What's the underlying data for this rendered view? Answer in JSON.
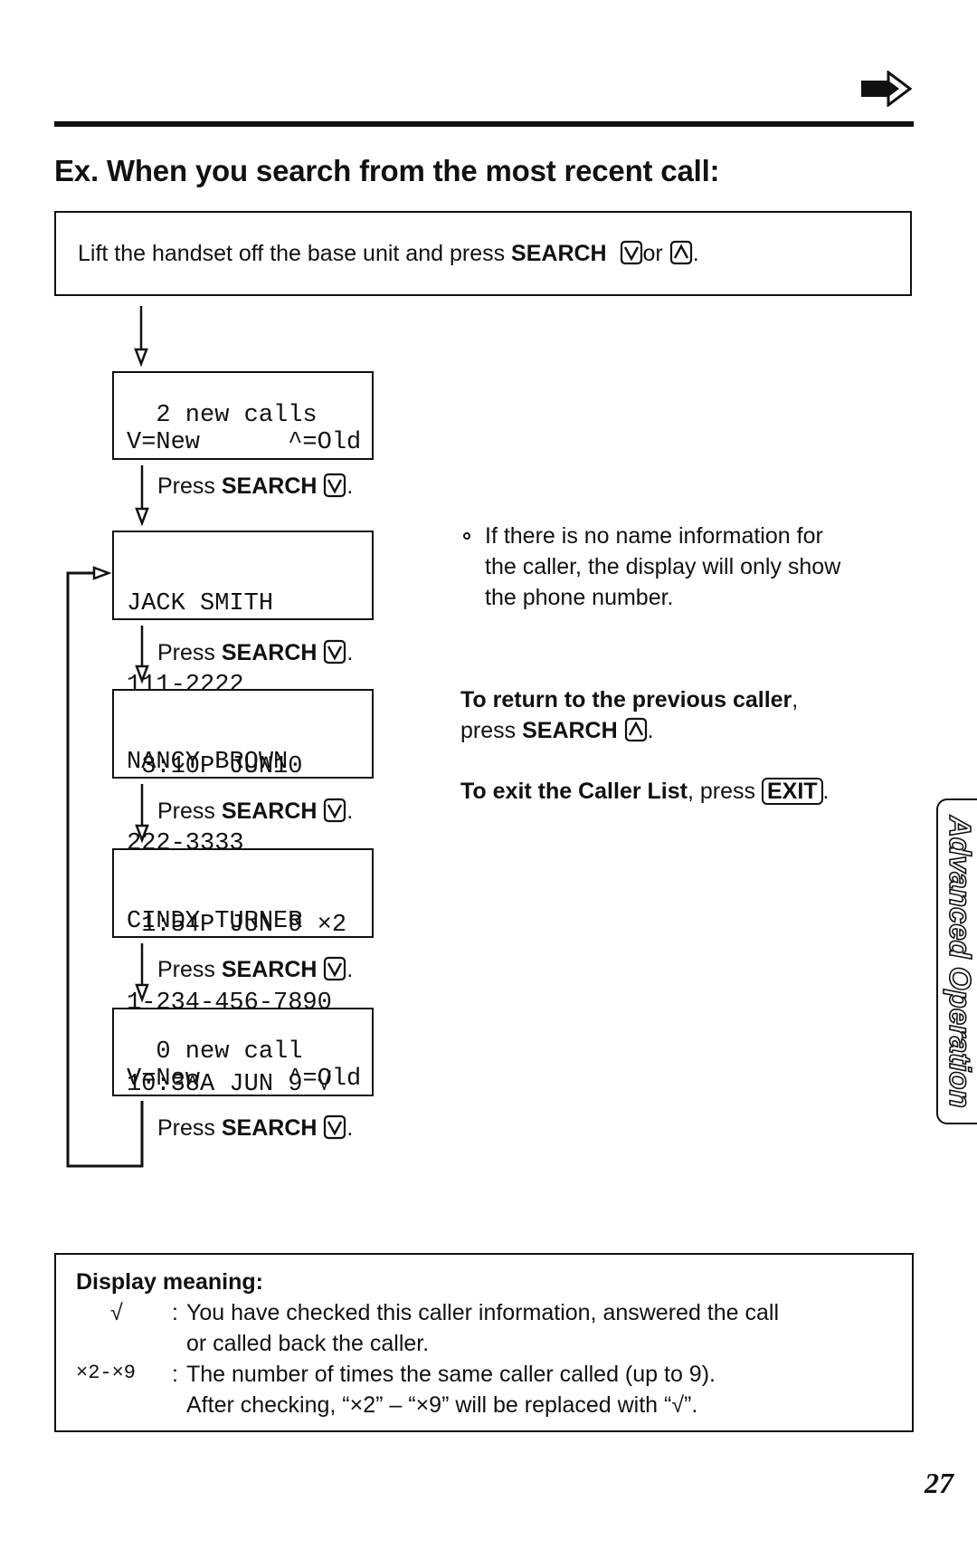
{
  "header": {
    "next_page_icon": "next-page-arrow-icon",
    "title": "Ex. When you search from the most recent call:"
  },
  "instruction": {
    "text_before": "Lift the handset off the base unit and press ",
    "key_label": "SEARCH",
    "or": "or",
    "end": ".",
    "down_key_icon": "search-down-key-icon",
    "up_key_icon": "search-up-key-icon"
  },
  "displays": [
    {
      "lines": [
        "  2 new calls",
        "V=New      ^=Old"
      ]
    },
    {
      "lines": [
        "JACK SMITH",
        "111-2222",
        " 3:10P JUN10"
      ]
    },
    {
      "lines": [
        "NANCY BROWN",
        "222-3333",
        " 1:54P JUN 9 ×2"
      ]
    },
    {
      "lines": [
        "CINDY TURNER",
        "1-234-456-7890",
        "10:38A JUN 9 √"
      ]
    },
    {
      "lines": [
        "  0 new call",
        "V=New      ^=Old"
      ]
    }
  ],
  "step": {
    "press": "Press ",
    "key_label": "SEARCH",
    "end": "."
  },
  "notes": {
    "bullet": "If there is no name information for",
    "bullet_line2": "the caller, the display will only show",
    "bullet_line3": "the phone number.",
    "return_bold": "To return to the previous caller",
    "return_comma": ",",
    "return_press": "press ",
    "return_key": "SEARCH",
    "return_end": ".",
    "exit_bold": "To exit the Caller List",
    "exit_press": ", press ",
    "exit_key": "EXIT",
    "exit_end": "."
  },
  "display_meaning": {
    "heading": "Display meaning:",
    "items": [
      {
        "symbol": "√",
        "colon": ":",
        "text": "You have checked this caller information, answered the call",
        "text2": "or called back the caller."
      },
      {
        "symbol": "×2-×9",
        "colon": ":",
        "text": "The number of times the same caller called (up to 9).",
        "text2": "After checking, “×2” – “×9” will be replaced with “√”."
      }
    ]
  },
  "side_tab": {
    "label": "Advanced Operation"
  },
  "page_number": "27"
}
